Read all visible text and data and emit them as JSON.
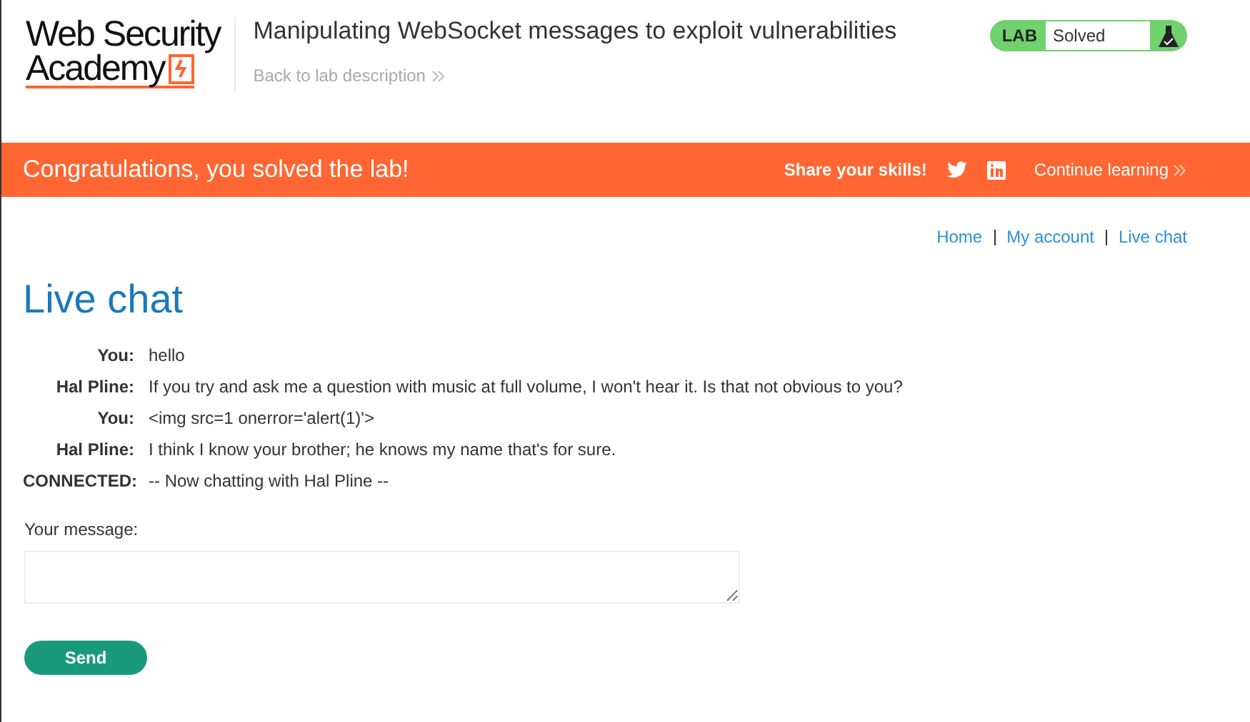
{
  "logo": {
    "line_1": "Web Security",
    "line_2": "Academy"
  },
  "header": {
    "title": "Manipulating WebSocket messages to exploit vulnerabilities",
    "back_link": "Back to lab description"
  },
  "lab_status": {
    "label": "LAB",
    "text": "Solved",
    "solved": true
  },
  "banner": {
    "message": "Congratulations, you solved the lab!",
    "share": "Share your skills!",
    "continue": "Continue learning"
  },
  "nav": [
    "Home",
    "My account",
    "Live chat"
  ],
  "page_title": "Live chat",
  "chat": [
    {
      "speaker": "You:",
      "text": "hello"
    },
    {
      "speaker": "Hal Pline:",
      "text": "If you try and ask me a question with music at full volume, I won't hear it. Is that not obvious to you?"
    },
    {
      "speaker": "You:",
      "text": "<img src=1 onerror='alert(1)'>"
    },
    {
      "speaker": "Hal Pline:",
      "text": "I think I know your brother; he knows my name that's for sure."
    },
    {
      "speaker": "CONNECTED:",
      "text": "-- Now chatting with Hal Pline --"
    }
  ],
  "form": {
    "label": "Your message:",
    "button": "Send"
  }
}
